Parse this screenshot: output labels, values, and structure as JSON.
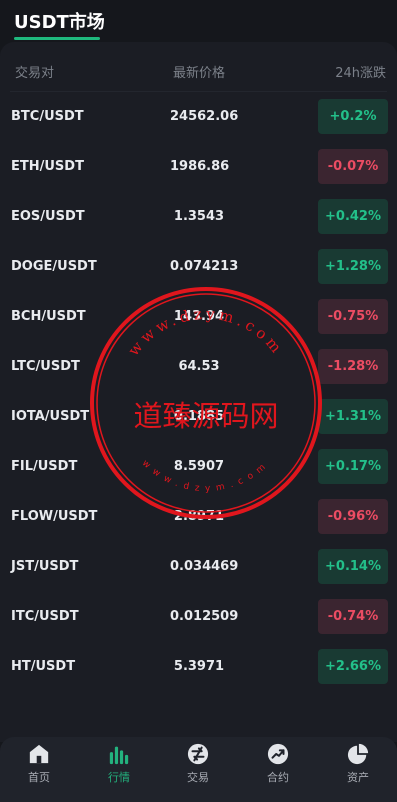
{
  "header": {
    "title": "USDT市场"
  },
  "columns": {
    "pair": "交易对",
    "price": "最新价格",
    "change": "24h涨跌"
  },
  "rows": [
    {
      "pair": "BTC/USDT",
      "price": "24562.06",
      "change": "+0.2%",
      "dir": "up"
    },
    {
      "pair": "ETH/USDT",
      "price": "1986.86",
      "change": "-0.07%",
      "dir": "down"
    },
    {
      "pair": "EOS/USDT",
      "price": "1.3543",
      "change": "+0.42%",
      "dir": "up"
    },
    {
      "pair": "DOGE/USDT",
      "price": "0.074213",
      "change": "+1.28%",
      "dir": "up"
    },
    {
      "pair": "BCH/USDT",
      "price": "143.94",
      "change": "-0.75%",
      "dir": "down"
    },
    {
      "pair": "LTC/USDT",
      "price": "64.53",
      "change": "-1.28%",
      "dir": "down"
    },
    {
      "pair": "IOTA/USDT",
      "price": "0.1885",
      "change": "+1.31%",
      "dir": "up"
    },
    {
      "pair": "FIL/USDT",
      "price": "8.5907",
      "change": "+0.17%",
      "dir": "up"
    },
    {
      "pair": "FLOW/USDT",
      "price": "2.8971",
      "change": "-0.96%",
      "dir": "down"
    },
    {
      "pair": "JST/USDT",
      "price": "0.034469",
      "change": "+0.14%",
      "dir": "up"
    },
    {
      "pair": "ITC/USDT",
      "price": "0.012509",
      "change": "-0.74%",
      "dir": "down"
    },
    {
      "pair": "HT/USDT",
      "price": "5.3971",
      "change": "+2.66%",
      "dir": "up"
    }
  ],
  "nav": [
    {
      "label": "首页",
      "icon": "home-icon"
    },
    {
      "label": "行情",
      "icon": "chart-bars-icon",
      "active": true
    },
    {
      "label": "交易",
      "icon": "exchange-icon"
    },
    {
      "label": "合约",
      "icon": "trend-up-icon"
    },
    {
      "label": "资产",
      "icon": "pie-chart-icon"
    }
  ],
  "watermark": {
    "text": "道臻源码网",
    "url_text": "www.dzym.com"
  },
  "colors": {
    "accent": "#1fb97e",
    "up": "#23c08a",
    "down": "#ec4c63",
    "watermark": "#e0161d"
  }
}
